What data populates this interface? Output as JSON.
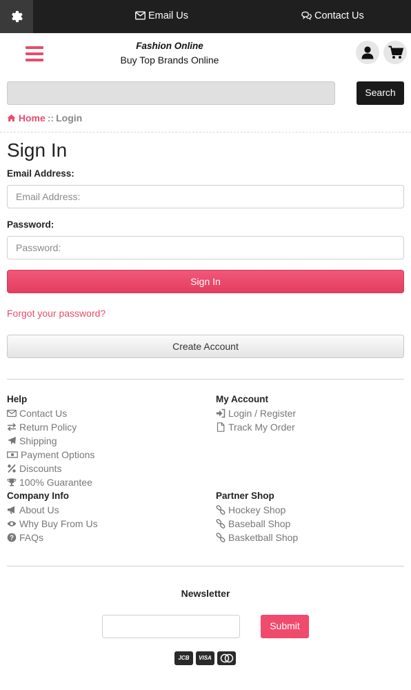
{
  "topbar": {
    "email_label": "Email Us",
    "contact_label": "Contact Us"
  },
  "header": {
    "brand_title": "Fashion Online",
    "brand_subtitle": "Buy Top Brands Online"
  },
  "search": {
    "placeholder": "",
    "button_label": "Search"
  },
  "breadcrumb": {
    "home": "Home",
    "separator": "::",
    "current": "Login"
  },
  "signin_form": {
    "title": "Sign In",
    "email_label": "Email Address:",
    "email_placeholder": "Email Address:",
    "password_label": "Password:",
    "password_placeholder": "Password:",
    "submit_label": "Sign In",
    "forgot_label": "Forgot your password?",
    "create_label": "Create Account"
  },
  "footer": {
    "help": {
      "heading": "Help",
      "links": [
        "Contact Us",
        "Return Policy",
        "Shipping",
        "Payment Options",
        "Discounts",
        "100% Guarantee"
      ]
    },
    "account": {
      "heading": "My Account",
      "links": [
        "Login / Register",
        "Track My Order"
      ]
    },
    "company": {
      "heading": "Company Info",
      "links": [
        "About Us",
        "Why Buy From Us",
        "FAQs"
      ]
    },
    "partner": {
      "heading": "Partner Shop",
      "links": [
        "Hockey Shop",
        "Baseball Shop",
        "Basketball Shop"
      ]
    }
  },
  "newsletter": {
    "title": "Newsletter",
    "input_value": "",
    "submit_label": "Submit"
  },
  "payment_cards": [
    {
      "icon": "jcb-card-icon",
      "label": "JCB"
    },
    {
      "icon": "visa-card-icon",
      "label": "VISA"
    },
    {
      "icon": "mastercard-card-icon",
      "label": ""
    }
  ],
  "colors": {
    "accent": "#e84c6a",
    "topbar": "#1f1f1f",
    "search_button": "#1a1a1a"
  }
}
